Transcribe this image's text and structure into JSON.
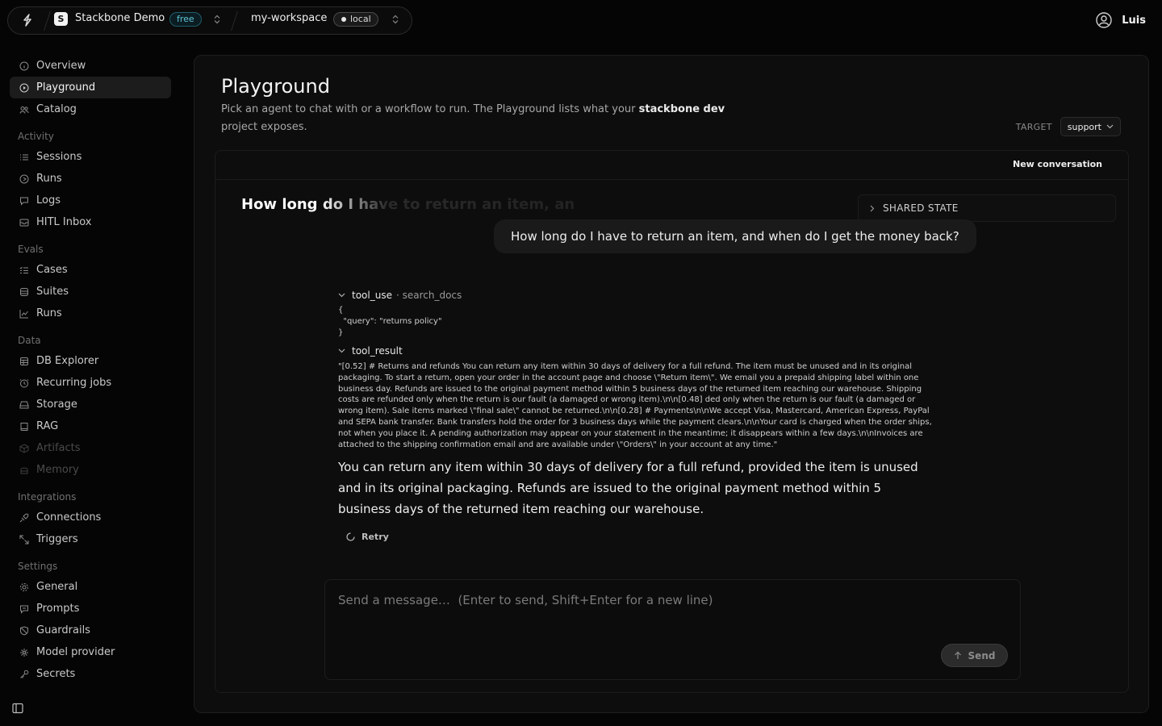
{
  "topbar": {
    "project_initial": "S",
    "project_name": "Stackbone Demo",
    "plan_badge": "free",
    "workspace_name": "my-workspace",
    "env_badge": "local",
    "user_name": "Luis"
  },
  "sidebar": {
    "top_items": [
      {
        "label": "Overview",
        "icon": "info-icon"
      },
      {
        "label": "Playground",
        "icon": "play-circle-icon",
        "active": true
      },
      {
        "label": "Catalog",
        "icon": "users-icon"
      }
    ],
    "sections": [
      {
        "title": "Activity",
        "items": [
          {
            "label": "Sessions",
            "icon": "list-icon"
          },
          {
            "label": "Runs",
            "icon": "play-circle-icon"
          },
          {
            "label": "Logs",
            "icon": "message-icon"
          },
          {
            "label": "HITL Inbox",
            "icon": "inbox-icon"
          }
        ]
      },
      {
        "title": "Evals",
        "items": [
          {
            "label": "Cases",
            "icon": "list-check-icon"
          },
          {
            "label": "Suites",
            "icon": "stack-icon"
          },
          {
            "label": "Runs",
            "icon": "chart-line-icon"
          }
        ]
      },
      {
        "title": "Data",
        "items": [
          {
            "label": "DB Explorer",
            "icon": "database-icon"
          },
          {
            "label": "Recurring jobs",
            "icon": "clock-icon"
          },
          {
            "label": "Storage",
            "icon": "drive-icon"
          },
          {
            "label": "RAG",
            "icon": "book-icon"
          },
          {
            "label": "Artifacts",
            "icon": "box-icon",
            "disabled": true
          },
          {
            "label": "Memory",
            "icon": "memory-icon",
            "disabled": true
          }
        ]
      },
      {
        "title": "Integrations",
        "items": [
          {
            "label": "Connections",
            "icon": "plug-icon"
          },
          {
            "label": "Triggers",
            "icon": "bolt-icon"
          }
        ]
      },
      {
        "title": "Settings",
        "items": [
          {
            "label": "General",
            "icon": "gear-icon"
          },
          {
            "label": "Prompts",
            "icon": "message-icon"
          },
          {
            "label": "Guardrails",
            "icon": "shield-icon"
          },
          {
            "label": "Model provider",
            "icon": "cpu-icon"
          },
          {
            "label": "Secrets",
            "icon": "key-icon"
          }
        ]
      }
    ]
  },
  "page": {
    "title": "Playground",
    "description_before": "Pick an agent to chat with or a workflow to run. The Playground lists what your ",
    "description_strong": "stackbone dev",
    "description_after": " project exposes.",
    "target_label": "TARGET",
    "target_value": "support"
  },
  "chat": {
    "new_conversation": "New conversation",
    "title": "How long do I have to return an item, an",
    "shared_state_label": "SHARED STATE",
    "user_message": "How long do I have to return an item, and when do I get the money back?",
    "tool_use": {
      "label": "tool_use",
      "tool_name": "· search_docs",
      "body": "{\n  \"query\": \"returns policy\"\n}"
    },
    "tool_result": {
      "label": "tool_result",
      "body": "\"[0.52] # Returns and refunds You can return any item within 30 days of delivery for a full refund. The item must be unused and in its original packaging. To start a return, open your order in the account page and choose \\\"Return item\\\". We email you a prepaid shipping label within one business day. Refunds are issued to the original payment method within 5 business days of the returned item reaching our warehouse. Shipping costs are refunded only when the return is our fault (a damaged or wrong item).\\n\\n[0.48] ded only when the return is our fault (a damaged or wrong item). Sale items marked \\\"final sale\\\" cannot be returned.\\n\\n[0.28] # Payments\\n\\nWe accept Visa, Mastercard, American Express, PayPal and SEPA bank transfer. Bank transfers hold the order for 3 business days while the payment clears.\\n\\nYour card is charged when the order ships, not when you place it. A pending authorization may appear on your statement in the meantime; it disappears within a few days.\\n\\nInvoices are attached to the shipping confirmation email and are available under \\\"Orders\\\" in your account at any time.\""
    },
    "assistant_message": "You can return any item within 30 days of delivery for a full refund, provided the item is unused and in its original packaging. Refunds are issued to the original payment method within 5 business days of the returned item reaching our warehouse.",
    "retry_label": "Retry",
    "composer_placeholder": "Send a message…  (Enter to send, Shift+Enter for a new line)",
    "send_label": "Send"
  }
}
